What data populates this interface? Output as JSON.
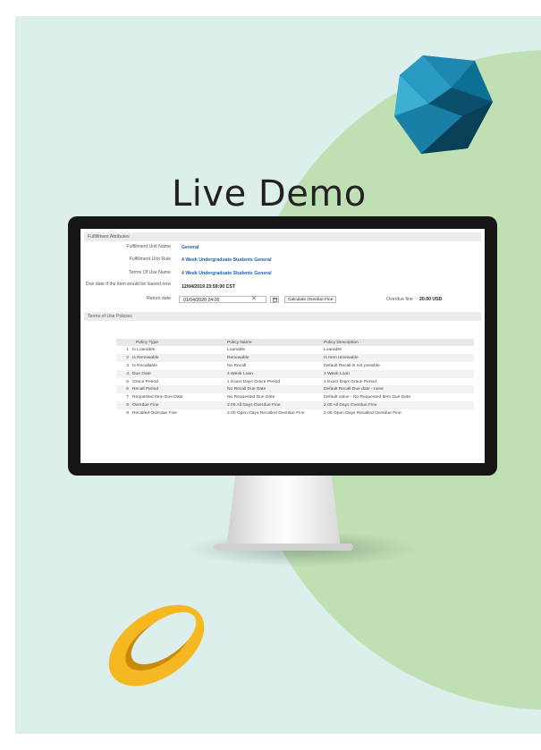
{
  "title": "Live Demo",
  "fulfillment": {
    "section_title": "Fulfillment Attributes",
    "rows": [
      {
        "label": "Fulfillment Unit Name",
        "value": "General"
      },
      {
        "label": "Fulfillment Unit Rule",
        "value": "4 Week Undergraduate Students General"
      },
      {
        "label": "Terms Of Use Name",
        "value": "4 Week Undergraduate Students General"
      },
      {
        "label": "Due date if the item would be loaned now",
        "value": "12/04/2019 23:59:00 CST"
      }
    ],
    "return_date_label": "Return date",
    "return_date_value": "01/04/2020 24:00",
    "calc_button": "Calculate Overdue Fine",
    "overdue_label": "Overdue fine",
    "overdue_value": "20.00 USD"
  },
  "policies": {
    "section_title": "Terms of Use Policies",
    "headers": [
      "Policy Type",
      "Policy Name",
      "Policy Description"
    ],
    "rows": [
      {
        "n": "1",
        "type": "Is Loanable",
        "name": "Loanable",
        "desc": "Loanable"
      },
      {
        "n": "2",
        "type": "Is Renewable",
        "name": "Renewable",
        "desc": "Is Item renewable"
      },
      {
        "n": "3",
        "type": "Is Recallable",
        "name": "No Recall",
        "desc": "Default Recall is not possible"
      },
      {
        "n": "4",
        "type": "Due Date",
        "name": "4 Week Loan",
        "desc": "4 Week Loan"
      },
      {
        "n": "5",
        "type": "Grace Period",
        "name": "1 Exact Days Grace Period",
        "desc": "1 Exact Days Grace Period"
      },
      {
        "n": "6",
        "type": "Recall Period",
        "name": "No Recall Due Date",
        "desc": "Default Recall Due date - none"
      },
      {
        "n": "7",
        "type": "Requested Item Due Date",
        "name": "No Requested Due Date",
        "desc": "Default value - No Requested Item Due Date"
      },
      {
        "n": "8",
        "type": "Overdue Fine",
        "name": "2.00 All Days Overdue Fine",
        "desc": "2.00 All Days Overdue Fine"
      },
      {
        "n": "9",
        "type": "Recalled Overdue Fine",
        "name": "2.00 Open Days Recalled Overdue Fine",
        "desc": "2.00 Open Days Recalled Overdue Fine"
      }
    ]
  },
  "icons": {
    "clear": "close-icon",
    "calendar": "calendar-icon",
    "gem": "geometric-gem-icon",
    "ring": "ring-icon"
  },
  "colors": {
    "background": "#dcefed",
    "green_circle": "#bfe0b2",
    "link": "#1f5fae",
    "monitor": "#161616"
  }
}
